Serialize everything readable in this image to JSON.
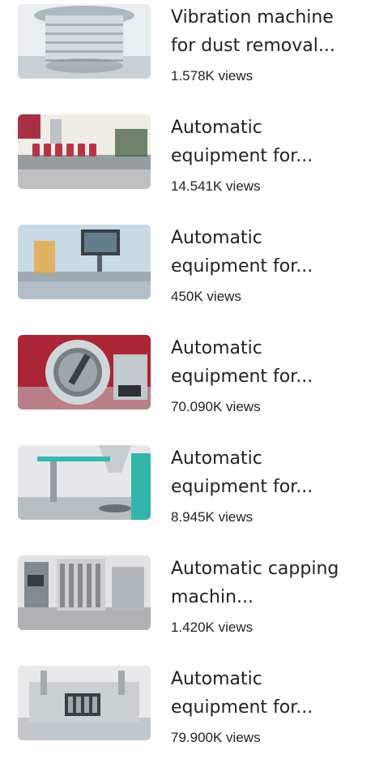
{
  "videos": [
    {
      "title": "Vibration machine for dust removal...",
      "views": "1.578K views",
      "thumbnail": "vibration-sieve-thumbnail",
      "palette": [
        "#e9eef2",
        "#aab4bc",
        "#7d8891"
      ]
    },
    {
      "title": "Automatic equipment for...",
      "views": "14.541K views",
      "thumbnail": "bottle-filling-line-thumbnail",
      "palette": [
        "#f0ece6",
        "#8f979c",
        "#b02a3a"
      ]
    },
    {
      "title": "Automatic equipment for...",
      "views": "450K views",
      "thumbnail": "labeling-machine-thumbnail",
      "palette": [
        "#c6d8e6",
        "#9aa4aa",
        "#4e5a62"
      ]
    },
    {
      "title": "Automatic equipment for...",
      "views": "70.090K views",
      "thumbnail": "mixing-tank-thumbnail",
      "palette": [
        "#a5192b",
        "#c3c8cc",
        "#6f767b"
      ]
    },
    {
      "title": "Automatic equipment for...",
      "views": "8.945K views",
      "thumbnail": "powder-filler-thumbnail",
      "palette": [
        "#e3e7e9",
        "#8c969c",
        "#2bb3a8"
      ]
    },
    {
      "title": "Automatic capping machin...",
      "views": "1.420K views",
      "thumbnail": "capping-machine-thumbnail",
      "palette": [
        "#dfe2e3",
        "#7b8388",
        "#3e464b"
      ]
    },
    {
      "title": "Automatic equipment for...",
      "views": "79.900K views",
      "thumbnail": "blister-packing-thumbnail",
      "palette": [
        "#e6e9ea",
        "#9da5aa",
        "#2e3438"
      ]
    }
  ]
}
